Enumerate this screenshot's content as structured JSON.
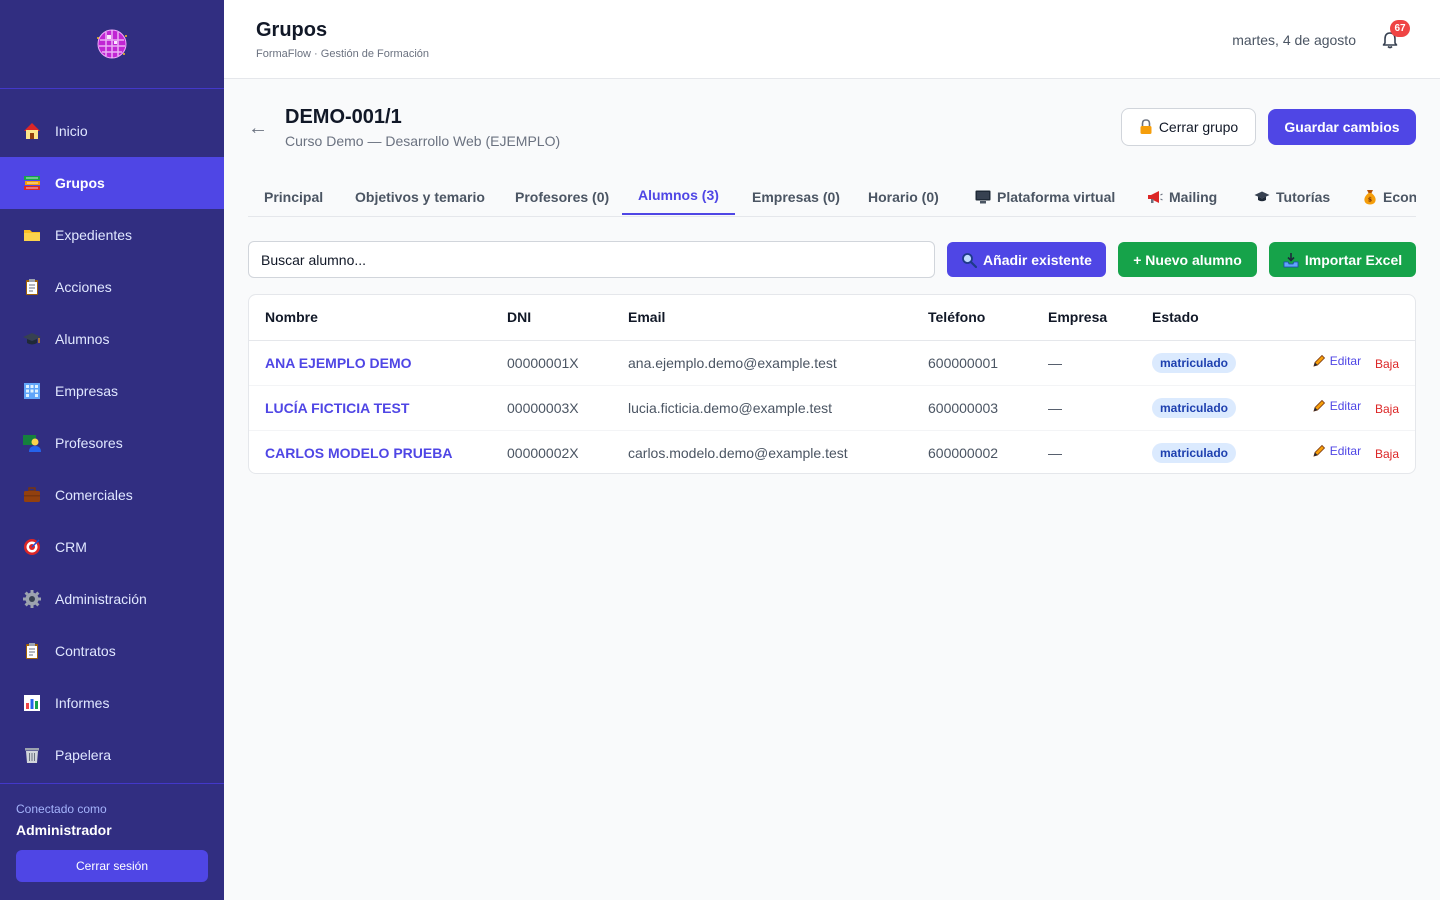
{
  "sidebar": {
    "items": [
      {
        "label": "Inicio",
        "icon": "house-icon"
      },
      {
        "label": "Grupos",
        "icon": "books-icon",
        "active": true
      },
      {
        "label": "Expedientes",
        "icon": "folder-icon"
      },
      {
        "label": "Acciones",
        "icon": "clipboard-icon"
      },
      {
        "label": "Alumnos",
        "icon": "graduation-cap-icon"
      },
      {
        "label": "Empresas",
        "icon": "office-building-icon"
      },
      {
        "label": "Profesores",
        "icon": "teacher-icon"
      },
      {
        "label": "Comerciales",
        "icon": "briefcase-icon"
      },
      {
        "label": "CRM",
        "icon": "target-icon"
      },
      {
        "label": "Administración",
        "icon": "gear-icon"
      },
      {
        "label": "Contratos",
        "icon": "clipboard-icon"
      },
      {
        "label": "Informes",
        "icon": "bar-chart-icon"
      },
      {
        "label": "Papelera",
        "icon": "trash-icon"
      }
    ],
    "footer": {
      "connected_label": "Conectado como",
      "user": "Administrador",
      "logout": "Cerrar sesión"
    }
  },
  "header": {
    "title": "Grupos",
    "subtitle": "FormaFlow · Gestión de Formación",
    "date": "martes, 4 de agosto",
    "notifications": "67"
  },
  "group": {
    "code": "DEMO-001/1",
    "course": "Curso Demo — Desarrollo Web (EJEMPLO)",
    "close_label": "Cerrar grupo",
    "save_label": "Guardar cambios"
  },
  "tabs": [
    {
      "label": "Principal"
    },
    {
      "label": "Objetivos y temario"
    },
    {
      "label": "Profesores (0)"
    },
    {
      "label": "Alumnos (3)",
      "active": true
    },
    {
      "label": "Empresas (0)"
    },
    {
      "label": "Horario (0)"
    },
    {
      "label": "Plataforma virtual",
      "icon": "computer-icon"
    },
    {
      "label": "Mailing",
      "icon": "megaphone-icon"
    },
    {
      "label": "Tutorías",
      "icon": "graduation-cap-icon"
    },
    {
      "label": "Economía",
      "icon": "money-bag-icon"
    }
  ],
  "toolbar": {
    "search_placeholder": "Buscar alumno...",
    "add_existing": "Añadir existente",
    "new_student": "+ Nuevo alumno",
    "import_excel": "Importar Excel"
  },
  "table": {
    "columns": [
      "Nombre",
      "DNI",
      "Email",
      "Teléfono",
      "Empresa",
      "Estado"
    ],
    "rows": [
      {
        "name": "ANA EJEMPLO DEMO",
        "dni": "00000001X",
        "email": "ana.ejemplo.demo@example.test",
        "phone": "600000001",
        "company": "—",
        "status": "matriculado"
      },
      {
        "name": "LUCÍA FICTICIA TEST",
        "dni": "00000003X",
        "email": "lucia.ficticia.demo@example.test",
        "phone": "600000003",
        "company": "—",
        "status": "matriculado"
      },
      {
        "name": "CARLOS MODELO PRUEBA",
        "dni": "00000002X",
        "email": "carlos.modelo.demo@example.test",
        "phone": "600000002",
        "company": "—",
        "status": "matriculado"
      }
    ],
    "edit_label": "Editar",
    "remove_label": "Baja"
  },
  "colors": {
    "sidebar_bg": "#312e81",
    "accent": "#4f46e5",
    "success": "#16a34a",
    "danger": "#dc2626"
  }
}
